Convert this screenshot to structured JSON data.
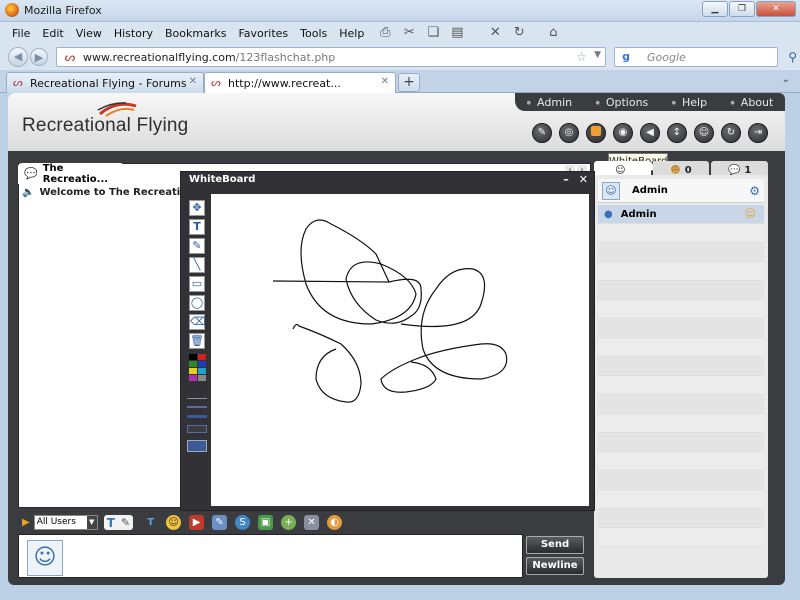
{
  "browser": {
    "window_title": "Mozilla Firefox",
    "menu": [
      "File",
      "Edit",
      "View",
      "History",
      "Bookmarks",
      "Favorites",
      "Tools",
      "Help"
    ],
    "url_host": "www.recreationalflying.com",
    "url_path": "/123flashchat.php",
    "search_placeholder": "Google",
    "tabs": [
      {
        "label": "Recreational Flying - Forums",
        "active": false
      },
      {
        "label": "http://www.recreat...",
        "active": true
      }
    ]
  },
  "app": {
    "logo_text": "Recreational Flying",
    "top_links": [
      "Admin",
      "Options",
      "Help",
      "About"
    ],
    "tooltip": "WhiteBoard",
    "room_tab": "The Recreatio...",
    "welcome": "Welcome to The Recreational F",
    "right_tabs": [
      {
        "icon": "users-icon",
        "count": ""
      },
      {
        "icon": "group-icon",
        "count": "0"
      },
      {
        "icon": "chat-bubble-icon",
        "count": "1"
      }
    ],
    "current_user": "Admin",
    "users": [
      "Admin"
    ],
    "room_select": "All Users",
    "send_label": "Send",
    "newline_label": "Newline",
    "whiteboard_title": "WhiteBoard",
    "whiteboard_min": "–",
    "whiteboard_close": "✕"
  },
  "colors": {
    "accent": "#f0a030",
    "panel_dark": "#3b3c40",
    "selected_row": "#c9d6e8"
  }
}
